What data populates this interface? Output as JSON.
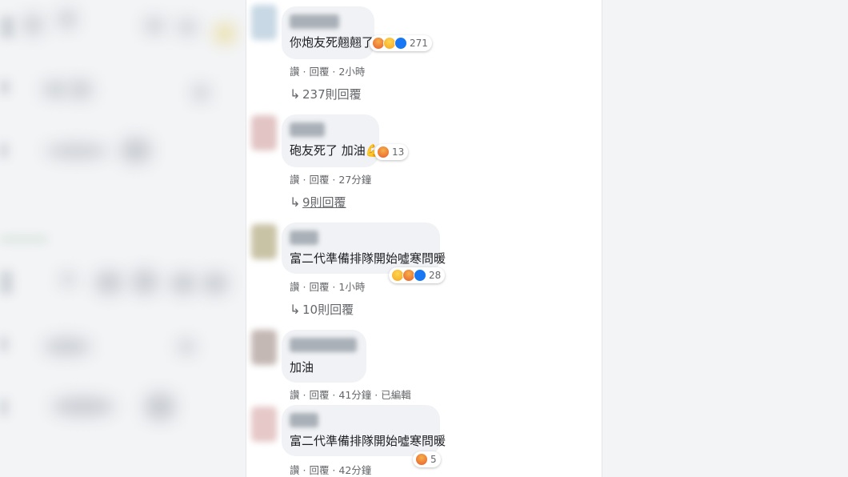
{
  "comments": [
    {
      "text": "你炮友死翹翹了",
      "reaction_count": "271",
      "reactions": [
        "angry",
        "haha",
        "like"
      ],
      "read": "讚",
      "reply": "回覆",
      "time": "2小時",
      "replies_label": "237則回覆"
    },
    {
      "text": "砲友死了 加油💪",
      "reaction_count": "13",
      "reactions": [
        "angry"
      ],
      "read": "讚",
      "reply": "回覆",
      "time": "27分鐘",
      "replies_label": "9則回覆"
    },
    {
      "text": "富二代準備排隊開始噓寒問暖",
      "reaction_count": "28",
      "reactions": [
        "haha",
        "angry",
        "like"
      ],
      "read": "讚",
      "reply": "回覆",
      "time": "1小時",
      "replies_label": "10則回覆"
    },
    {
      "text": "加油",
      "read": "讚",
      "reply": "回覆",
      "time": "41分鐘",
      "edited": "已編輯"
    },
    {
      "text": "富二代準備排隊開始噓寒問暖",
      "reaction_count": "5",
      "reactions": [
        "angry"
      ],
      "read": "讚",
      "reply": "回覆",
      "time": "42分鐘"
    }
  ],
  "separator": " · ",
  "reply_arrow": "↳",
  "colors": {
    "bubble": "#f0f2f5",
    "meta": "#65676b",
    "like": "#1877f2"
  }
}
